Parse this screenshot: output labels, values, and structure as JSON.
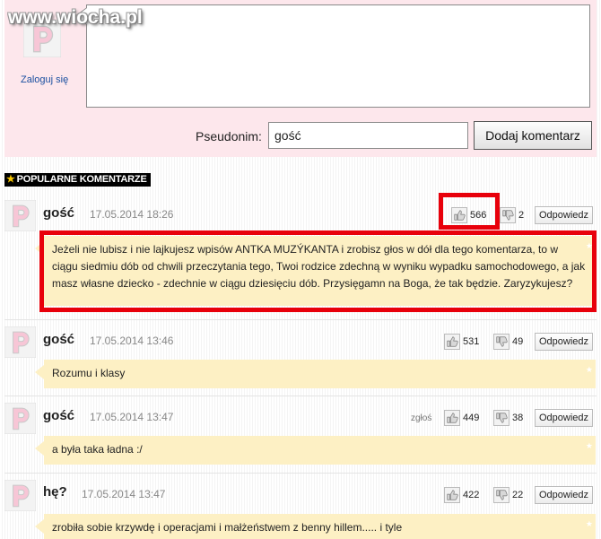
{
  "watermark": "www.wiocha.pl",
  "form": {
    "login_label": "Zaloguj się",
    "comment_placeholder": "",
    "pseudonim_label": "Pseudonim:",
    "pseudonim_value": "gość",
    "submit_label": "Dodaj komentarz"
  },
  "section": {
    "title": "POPULARNE KOMENTARZE"
  },
  "comments": [
    {
      "author": "gość",
      "date": "17.05.2014 18:26",
      "likes": "566",
      "dislikes": "2",
      "reply_label": "Odpowiedz",
      "report_label": "",
      "text": "Jeżeli nie lubisz i nie lajkujesz wpisów ANTKA MUZÝKANTA i zrobisz głos w dół dla tego komentarza, to w ciągu siedmiu dób od chwili przeczytania tego, Twoi rodzice zdechną w wyniku wypadku samochodowego, a jak masz własne dziecko - zdechnie w ciągu dziesięciu dób. Przysięgamn na Boga, że tak będzie. Zaryzykujesz?"
    },
    {
      "author": "gość",
      "date": "17.05.2014 13:46",
      "likes": "531",
      "dislikes": "49",
      "reply_label": "Odpowiedz",
      "report_label": "",
      "text": "Rozumu i klasy"
    },
    {
      "author": "gość",
      "date": "17.05.2014 13:47",
      "likes": "449",
      "dislikes": "38",
      "reply_label": "Odpowiedz",
      "report_label": "zgłoś",
      "text": "a była taka ładna :/"
    },
    {
      "author": "hę?",
      "date": "17.05.2014 13:47",
      "likes": "422",
      "dislikes": "22",
      "reply_label": "Odpowiedz",
      "report_label": "",
      "text": "zrobiła sobie krzywdę i operacjami i małżeństwem z benny hillem..... i tyle"
    }
  ],
  "colors": {
    "form_bg": "#fde7ec",
    "bubble_bg": "#fdf0c4",
    "highlight": "#e8000b",
    "header_bg": "#000000",
    "link": "#1a4fa0"
  },
  "icons": [
    "avatar-p-icon",
    "thumbs-up-icon",
    "thumbs-down-icon",
    "star-icon"
  ]
}
